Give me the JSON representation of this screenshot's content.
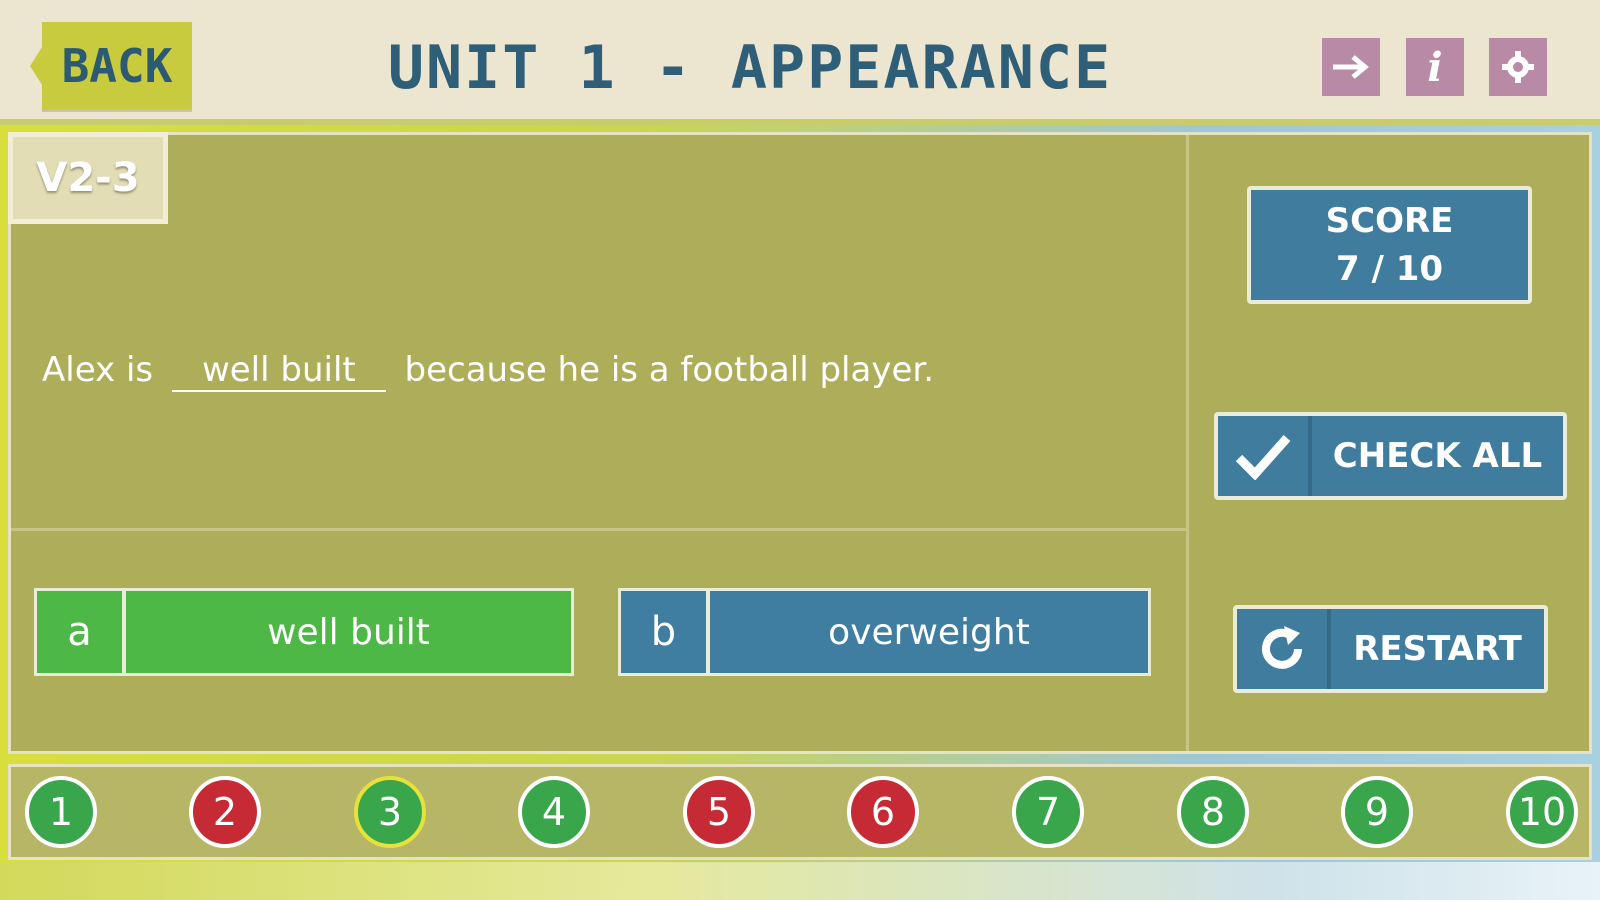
{
  "header": {
    "back_label": "BACK",
    "title": "UNIT 1 - APPEARANCE",
    "icons": [
      "arrow-right-icon",
      "info-icon",
      "gear-icon"
    ],
    "info_glyph": "i"
  },
  "level_tag": "V2-3",
  "question": {
    "before": "Alex is",
    "answer": "well built",
    "after": "because he is a football player."
  },
  "answers": [
    {
      "letter": "a",
      "text": "well built",
      "state": "correct"
    },
    {
      "letter": "b",
      "text": "overweight",
      "state": "neutral"
    }
  ],
  "score": {
    "label": "SCORE",
    "value": "7 / 10"
  },
  "buttons": {
    "check_all": "CHECK ALL",
    "restart": "RESTART"
  },
  "dots": [
    {
      "num": "1",
      "state": "correct"
    },
    {
      "num": "2",
      "state": "wrong"
    },
    {
      "num": "3",
      "state": "current"
    },
    {
      "num": "4",
      "state": "correct"
    },
    {
      "num": "5",
      "state": "wrong"
    },
    {
      "num": "6",
      "state": "wrong"
    },
    {
      "num": "7",
      "state": "correct"
    },
    {
      "num": "8",
      "state": "correct"
    },
    {
      "num": "9",
      "state": "correct"
    },
    {
      "num": "10",
      "state": "correct"
    }
  ],
  "colors": {
    "correct": "#3aa64b",
    "wrong": "#c62a34",
    "accent_blue": "#3f7c9d"
  }
}
